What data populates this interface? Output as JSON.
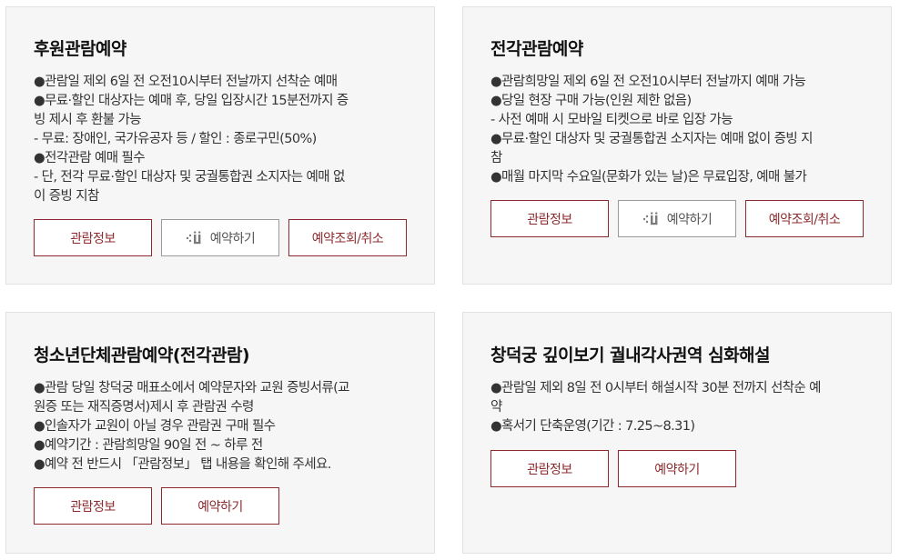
{
  "colors": {
    "accent": "#8c2a2e",
    "card_bg": "#f6f6f6",
    "ticket_icon": "#7a7a7a"
  },
  "icons": {
    "ticket": "ticket-icon"
  },
  "cards": [
    {
      "title": "후원관람예약",
      "lines": [
        "●관람일 제외 6일 전 오전10시부터 전날까지 선착순 예매",
        "●무료·할인 대상자는 예매 후, 당일 입장시간 15분전까지 증",
        "빙 제시 후 환불 가능",
        " - 무료: 장애인, 국가유공자 등 / 할인 : 종로구민(50%)",
        "●전각관람 예매 필수",
        " - 단, 전각 무료·할인 대상자 및 궁궐통합권 소지자는 예매 없",
        "이 증빙 지참"
      ],
      "buttons": [
        "관람정보",
        "예약하기",
        "예약조회/취소"
      ]
    },
    {
      "title": "전각관람예약",
      "lines": [
        "●관람희망일 제외 6일 전 오전10시부터 전날까지 예매 가능",
        "●당일 현장 구매 가능(인원 제한 없음)",
        " - 사전 예매 시 모바일 티켓으로 바로 입장 가능",
        "●무료·할인 대상자 및 궁궐통합권 소지자는 예매 없이 증빙 지",
        "참",
        "●매월 마지막 수요일(문화가 있는 날)은 무료입장, 예매 불가"
      ],
      "buttons": [
        "관람정보",
        "예약하기",
        "예약조회/취소"
      ]
    },
    {
      "title": "청소년단체관람예약(전각관람)",
      "lines": [
        "●관람 당일 창덕궁 매표소에서 예약문자와 교원 증빙서류(교",
        "원증 또는 재직증명서)제시 후 관람권 수령",
        "●인솔자가 교원이 아닐 경우 관람권 구매 필수",
        "●예약기간 : 관람희망일 90일 전 ~ 하루 전",
        "●예약 전 반드시 「관람정보」 탭 내용을 확인해 주세요."
      ],
      "buttons": [
        "관람정보",
        "예약하기"
      ]
    },
    {
      "title": "창덕궁 깊이보기 궐내각사권역 심화해설",
      "lines": [
        "●관람일 제외 8일 전 0시부터 해설시작 30분 전까지 선착순 예",
        "약",
        "●혹서기 단축운영(기간 : 7.25~8.31)"
      ],
      "buttons": [
        "관람정보",
        "예약하기"
      ]
    }
  ]
}
